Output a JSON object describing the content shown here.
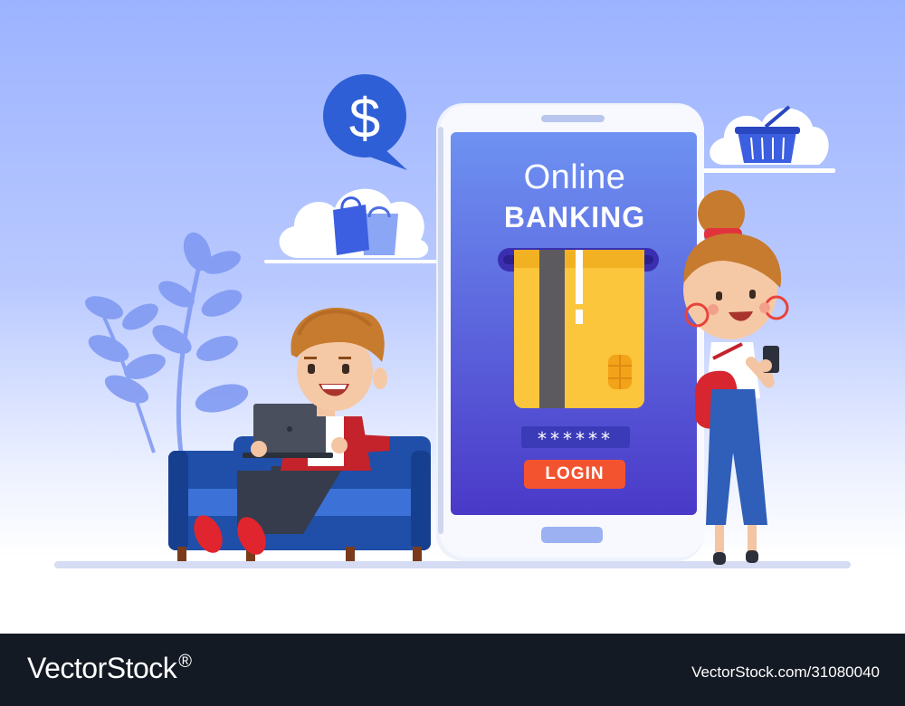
{
  "phone": {
    "title_line1": "Online",
    "title_line2": "BANKING",
    "pin_mask": "******",
    "login_label": "LOGIN"
  },
  "bubble": {
    "symbol": "$"
  },
  "footer": {
    "brand": "VectorStock",
    "brand_mark": "®",
    "stock_id": "VectorStock.com/31080040"
  },
  "colors": {
    "sky_top": "#9cb3ff",
    "phone_screen": "#6b8af0",
    "card": "#fbc53c",
    "login_button": "#f4532f",
    "sofa": "#1f4fa8",
    "footer_bg": "#141a24"
  },
  "icons": [
    "dollar-icon",
    "shopping-bags-icon",
    "basket-icon",
    "chip-icon"
  ]
}
